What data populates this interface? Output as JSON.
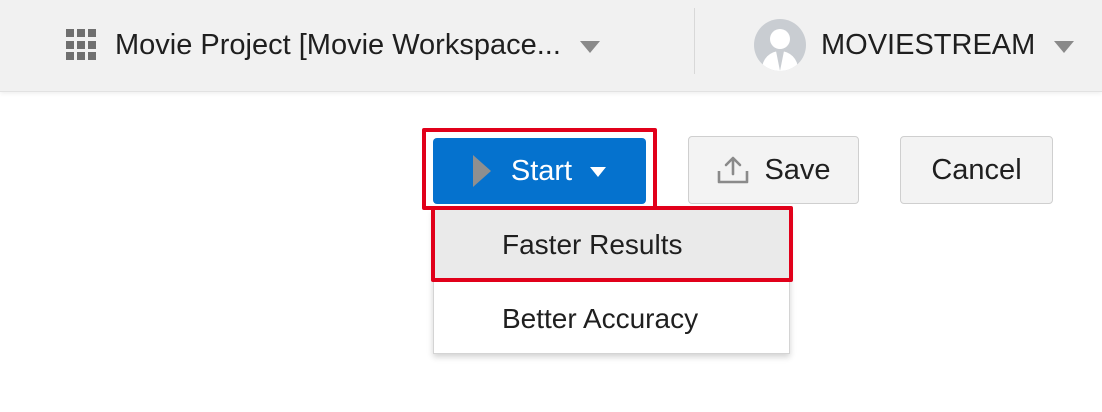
{
  "header": {
    "project_label": "Movie Project [Movie Workspace...",
    "project_icon": "grid-icon",
    "user_label": "MOVIESTREAM",
    "user_icon": "avatar-icon"
  },
  "toolbar": {
    "start_label": "Start",
    "start_icon": "play-icon",
    "save_label": "Save",
    "save_icon": "upload-icon",
    "cancel_label": "Cancel"
  },
  "start_menu": {
    "items": [
      {
        "label": "Faster Results"
      },
      {
        "label": "Better Accuracy"
      }
    ]
  },
  "colors": {
    "primary": "#0572ce",
    "highlight": "#e1001a",
    "topbar": "#f1f1f1"
  }
}
